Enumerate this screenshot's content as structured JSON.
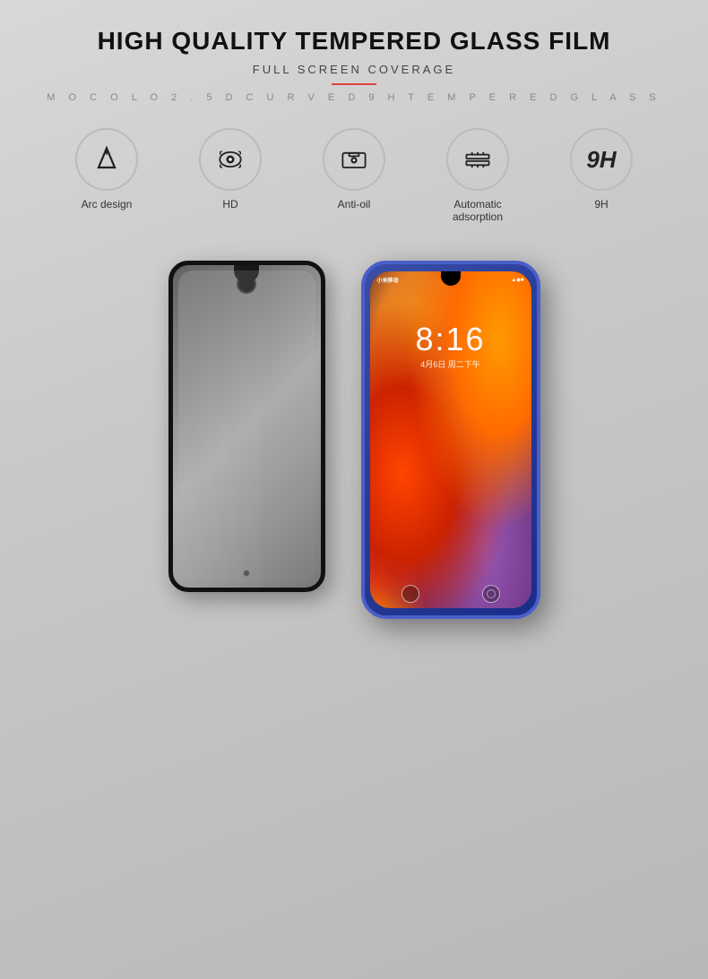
{
  "header": {
    "main_title": "HIGH QUALITY TEMPERED GLASS FILM",
    "subtitle": "FULL SCREEN COVERAGE",
    "tagline": "M O C O L O   2 . 5 D   C U R V E D   9 H   T E M P E R E D   G L A S S"
  },
  "features": [
    {
      "id": "arc",
      "label": "Arc design",
      "icon": "arc-icon"
    },
    {
      "id": "hd",
      "label": "HD",
      "icon": "hd-icon"
    },
    {
      "id": "antioil",
      "label": "Anti-oil",
      "icon": "antioil-icon"
    },
    {
      "id": "adsorption",
      "label": "Automatic adsorption",
      "icon": "adsorption-icon"
    },
    {
      "id": "9h",
      "label": "9H",
      "icon": "9h-icon"
    }
  ],
  "phone": {
    "carrier": "小米移动",
    "time": "8:16",
    "date": "4月6日 周二下午",
    "status_icons": "▲ ◆ ■"
  }
}
